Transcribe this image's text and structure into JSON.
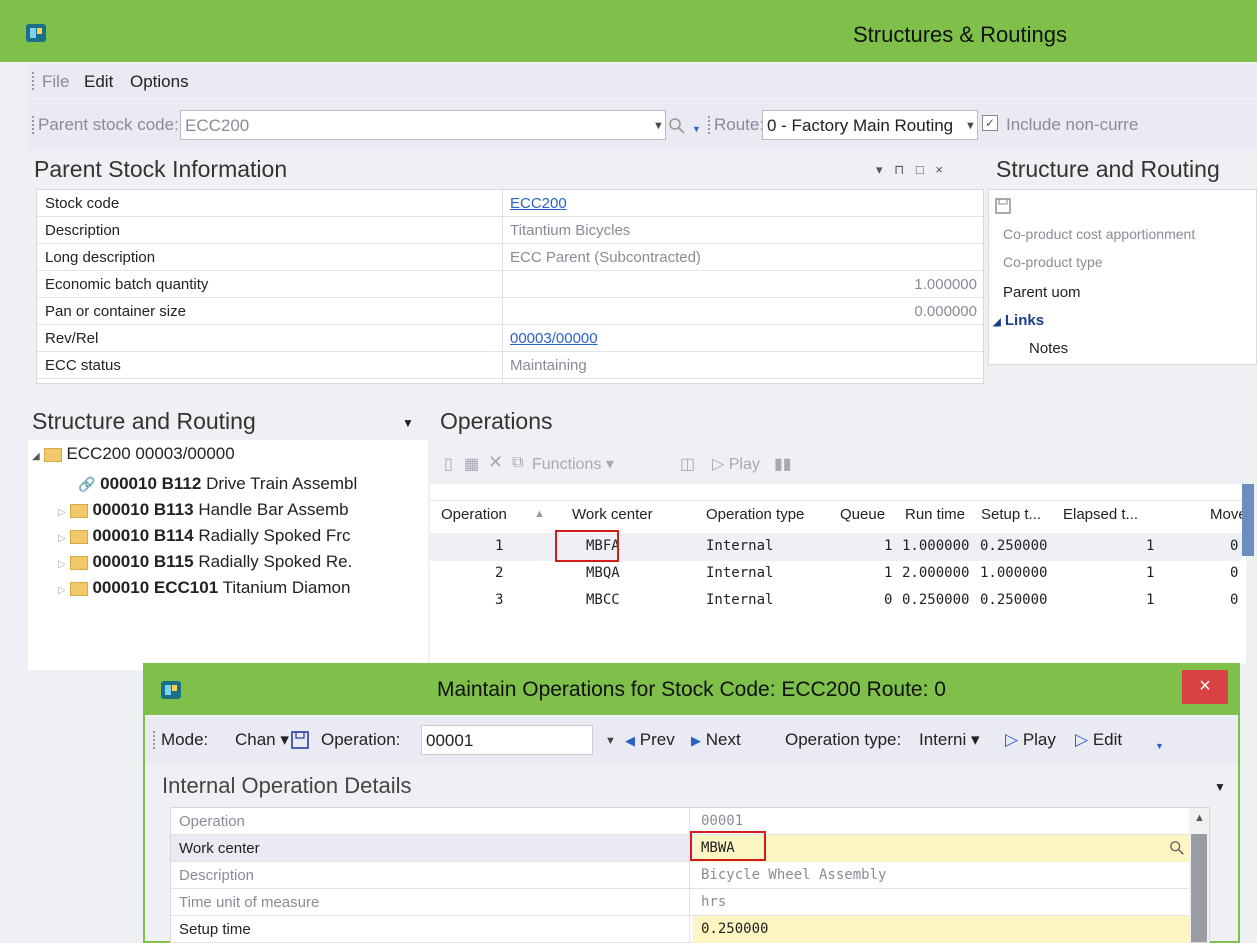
{
  "window": {
    "title": "Structures & Routings"
  },
  "menu": {
    "items": [
      "File",
      "Edit",
      "Options"
    ]
  },
  "toolbar": {
    "parent_label": "Parent stock code:",
    "parent_value": "ECC200",
    "route_label": "Route:",
    "route_value": "0  - Factory Main Routing",
    "include_label": "Include non-curre"
  },
  "parent_info": {
    "title": "Parent Stock Information",
    "rows": [
      {
        "label": "Stock code",
        "value": "ECC200"
      },
      {
        "label": "Description",
        "value": "Titantium Bicycles"
      },
      {
        "label": "Long description",
        "value": "ECC Parent (Subcontracted)"
      },
      {
        "label": "Economic batch quantity",
        "value": "1.000000"
      },
      {
        "label": "Pan or container size",
        "value": "0.000000"
      },
      {
        "label": "Rev/Rel",
        "value": "00003/00000"
      },
      {
        "label": "ECC status",
        "value": "Maintaining"
      }
    ]
  },
  "side_panel": {
    "title": "Structure and Routing",
    "rows": [
      "Co-product cost apportionment",
      "Co-product type",
      "Parent uom",
      "Links",
      "Notes"
    ]
  },
  "tree": {
    "title": "Structure and Routing",
    "root": "ECC200 00003/00000",
    "children": [
      {
        "code": "000010 B112",
        "desc": "Drive Train Assembl"
      },
      {
        "code": "000010 B113",
        "desc": "Handle Bar Assemb"
      },
      {
        "code": "000010 B114",
        "desc": "Radially Spoked Frc"
      },
      {
        "code": "000010 B115",
        "desc": "Radially Spoked Re."
      },
      {
        "code": "000010 ECC101",
        "desc": "Titanium Diamon"
      }
    ]
  },
  "operations": {
    "title": "Operations",
    "functions_label": "Functions",
    "play_label": "Play",
    "columns": [
      "Operation",
      "Work center",
      "Operation type",
      "Queue",
      "Run time",
      "Setup t...",
      "Elapsed t...",
      "Move"
    ],
    "rows": [
      [
        "1",
        "MBFA",
        "Internal",
        "1",
        "1.000000",
        "0.250000",
        "1",
        "0"
      ],
      [
        "2",
        "MBQA",
        "Internal",
        "1",
        "2.000000",
        "1.000000",
        "1",
        "0"
      ],
      [
        "3",
        "MBCC",
        "Internal",
        "0",
        "0.250000",
        "0.250000",
        "1",
        "0"
      ]
    ]
  },
  "dialog": {
    "title": "Maintain Operations for Stock Code: ECC200   Route: 0",
    "close": "×",
    "mode_label": "Mode:",
    "mode_value": "Chan",
    "operation_label": "Operation:",
    "operation_value": "00001",
    "prev_label": "Prev",
    "next_label": "Next",
    "optype_label": "Operation type:",
    "optype_value": "Interni",
    "play_label": "Play",
    "edit_label": "Edit",
    "section_title": "Internal Operation Details",
    "rows": [
      {
        "label": "Operation",
        "value": "00001"
      },
      {
        "label": "Work center",
        "value": "MBWA"
      },
      {
        "label": "Description",
        "value": "Bicycle Wheel Assembly"
      },
      {
        "label": "Time unit of measure",
        "value": "hrs"
      },
      {
        "label": "Setup time",
        "value": "0.250000"
      }
    ]
  },
  "colors": {
    "accent": "#7ec04a",
    "highlight": "#d21d1d",
    "link": "#2a62c9",
    "editable": "#fdf6c3"
  }
}
